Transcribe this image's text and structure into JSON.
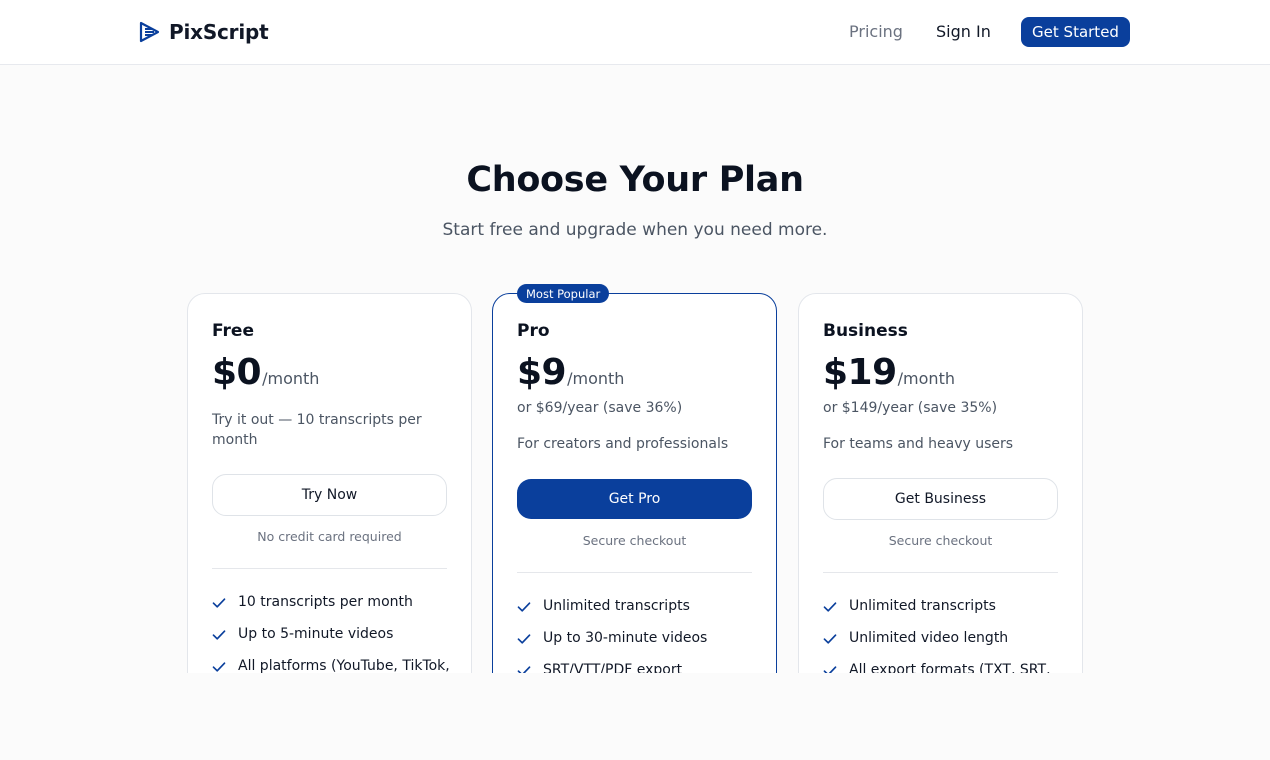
{
  "brand": {
    "name": "PixScript"
  },
  "nav": {
    "pricing": "Pricing",
    "sign_in": "Sign In",
    "get_started": "Get Started"
  },
  "hero": {
    "title": "Choose Your Plan",
    "subtitle": "Start free and upgrade when you need more."
  },
  "colors": {
    "accent": "#0a3f9c",
    "check": "#0a3f9c"
  },
  "plans": [
    {
      "name": "Free",
      "price": "$0",
      "period": "/month",
      "description": "Try it out — 10 transcripts per month",
      "button": "Try Now",
      "note": "No credit card required",
      "features": [
        "10 transcripts per month",
        "Up to 5-minute videos",
        "All platforms (YouTube, TikTok,"
      ]
    },
    {
      "name": "Pro",
      "badge": "Most Popular",
      "price": "$9",
      "period": "/month",
      "yearly": "or $69/year (save 36%)",
      "description": "For creators and professionals",
      "button": "Get Pro",
      "note": "Secure checkout",
      "features": [
        "Unlimited transcripts",
        "Up to 30-minute videos",
        "SRT/VTT/PDF export"
      ]
    },
    {
      "name": "Business",
      "price": "$19",
      "period": "/month",
      "yearly": "or $149/year (save 35%)",
      "description": "For teams and heavy users",
      "button": "Get Business",
      "note": "Secure checkout",
      "features": [
        "Unlimited transcripts",
        "Unlimited video length",
        "All export formats (TXT, SRT,"
      ]
    }
  ]
}
